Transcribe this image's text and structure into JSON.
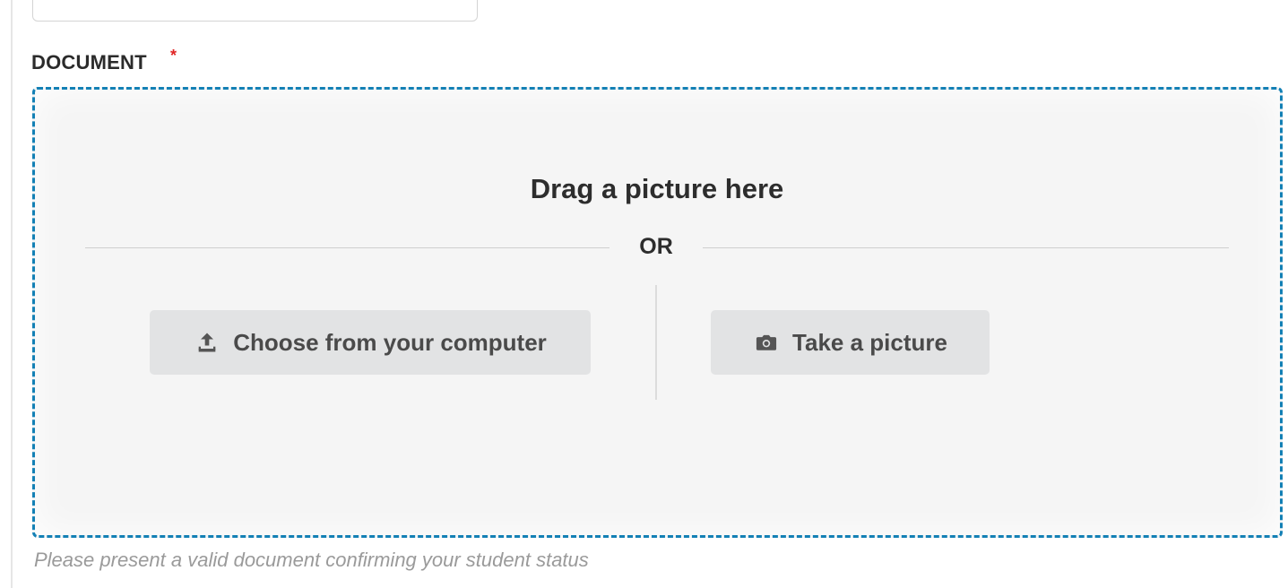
{
  "form": {
    "document_label": "DOCUMENT",
    "required_marker": "*",
    "helper_text": "Please present a valid document confirming your student status"
  },
  "dropzone": {
    "title": "Drag a picture here",
    "separator": "OR",
    "choose_button": {
      "label": "Choose from your computer",
      "icon": "upload-icon"
    },
    "take_button": {
      "label": "Take a picture",
      "icon": "camera-icon"
    },
    "border_color": "#1380b5"
  },
  "colors": {
    "required": "#e02424",
    "button_bg": "#e2e3e4",
    "dropzone_bg": "#f5f5f5"
  }
}
